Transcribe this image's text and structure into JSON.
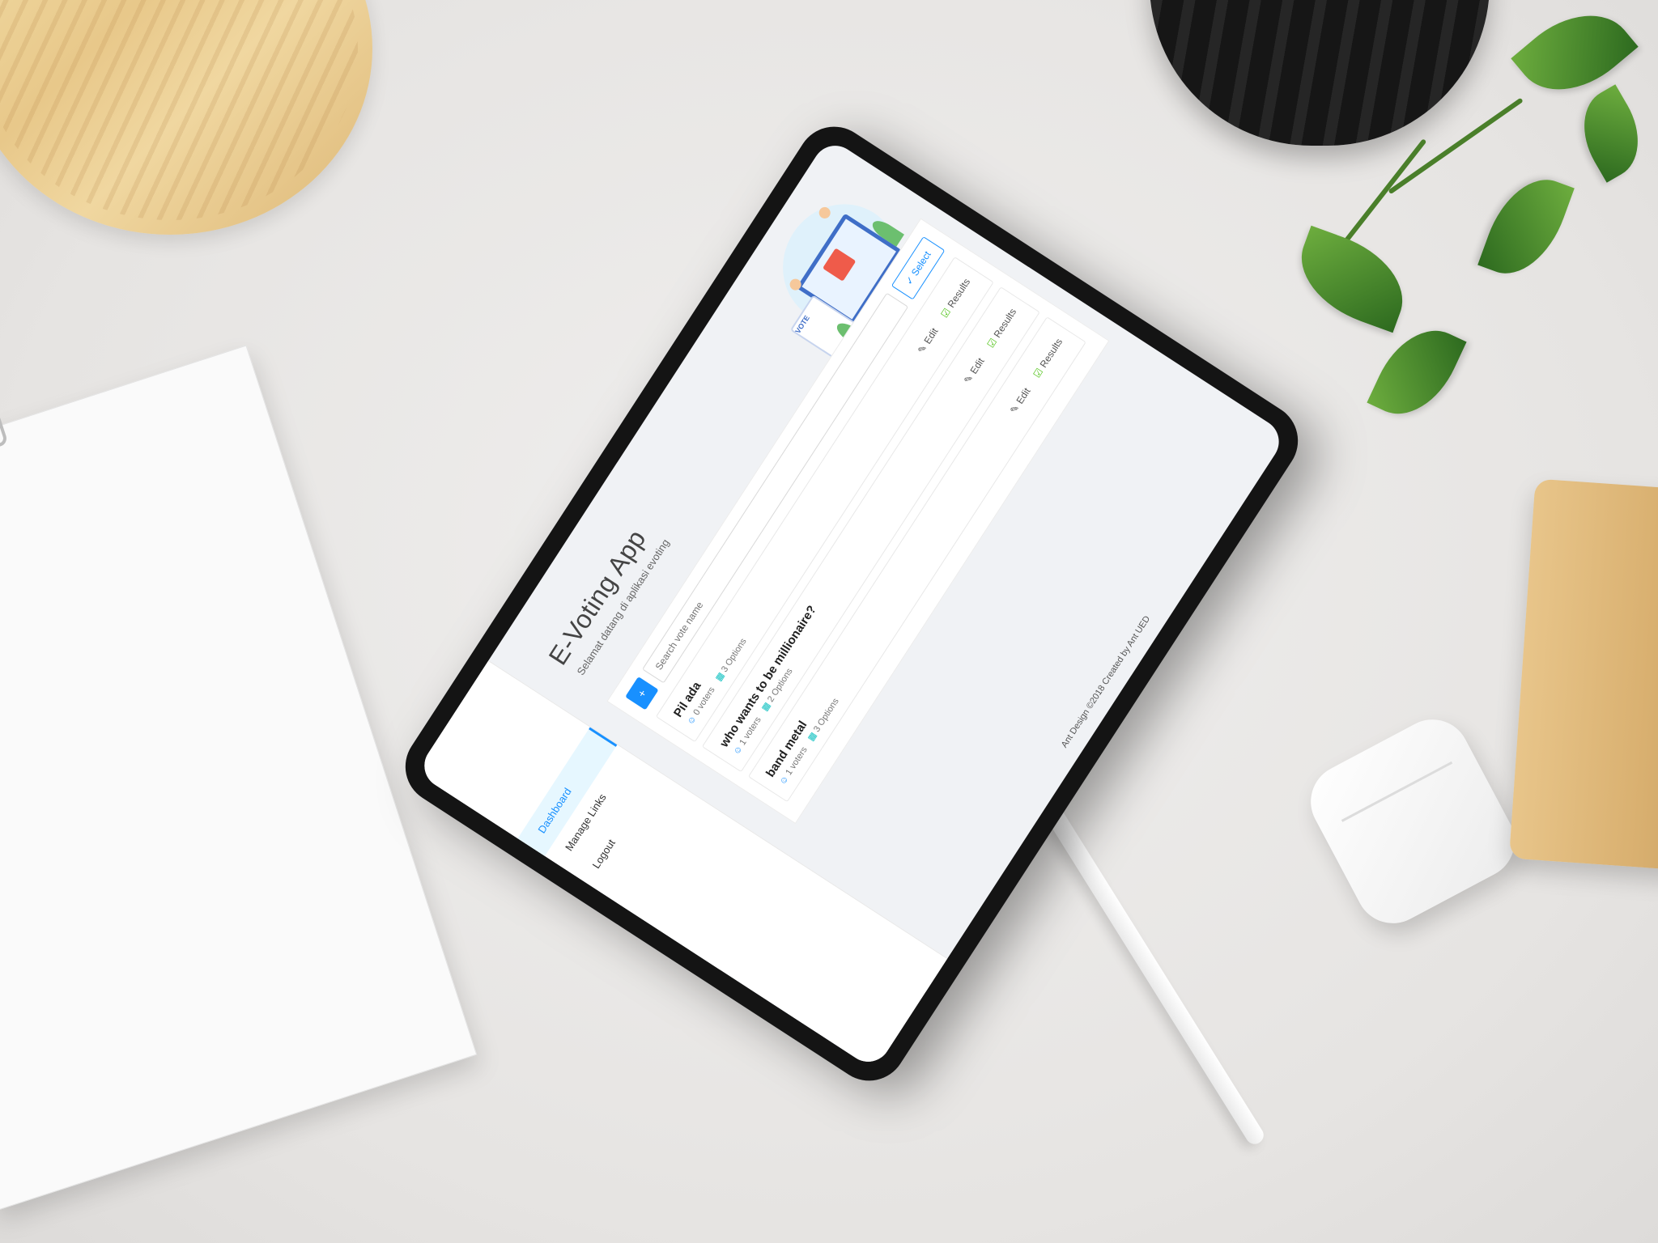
{
  "app": {
    "title": "E-Voting App",
    "subtitle": "Selamat datang di aplikasi evoting",
    "footer": "Ant Design ©2018 Created by Ant UED"
  },
  "sidebar": {
    "items": [
      {
        "label": "Dashboard",
        "active": true
      },
      {
        "label": "Manage Links",
        "active": false
      },
      {
        "label": "Logout",
        "active": false
      }
    ]
  },
  "toolbar": {
    "add_label": "+",
    "search_placeholder": "Search vote name",
    "select_label": "Select"
  },
  "polls": [
    {
      "title": "Pil ada",
      "voters": "0 voters",
      "options": "3 Options",
      "edit_label": "Edit",
      "results_label": "Results"
    },
    {
      "title": "who wants to be millionaire?",
      "voters": "1 voters",
      "options": "2 Options",
      "edit_label": "Edit",
      "results_label": "Results"
    },
    {
      "title": "band metal",
      "voters": "1 voters",
      "options": "3 Options",
      "edit_label": "Edit",
      "results_label": "Results"
    }
  ],
  "illustration": {
    "badge": "VOTE"
  },
  "colors": {
    "primary": "#1890ff",
    "success": "#52c41a",
    "device": "#141414"
  }
}
